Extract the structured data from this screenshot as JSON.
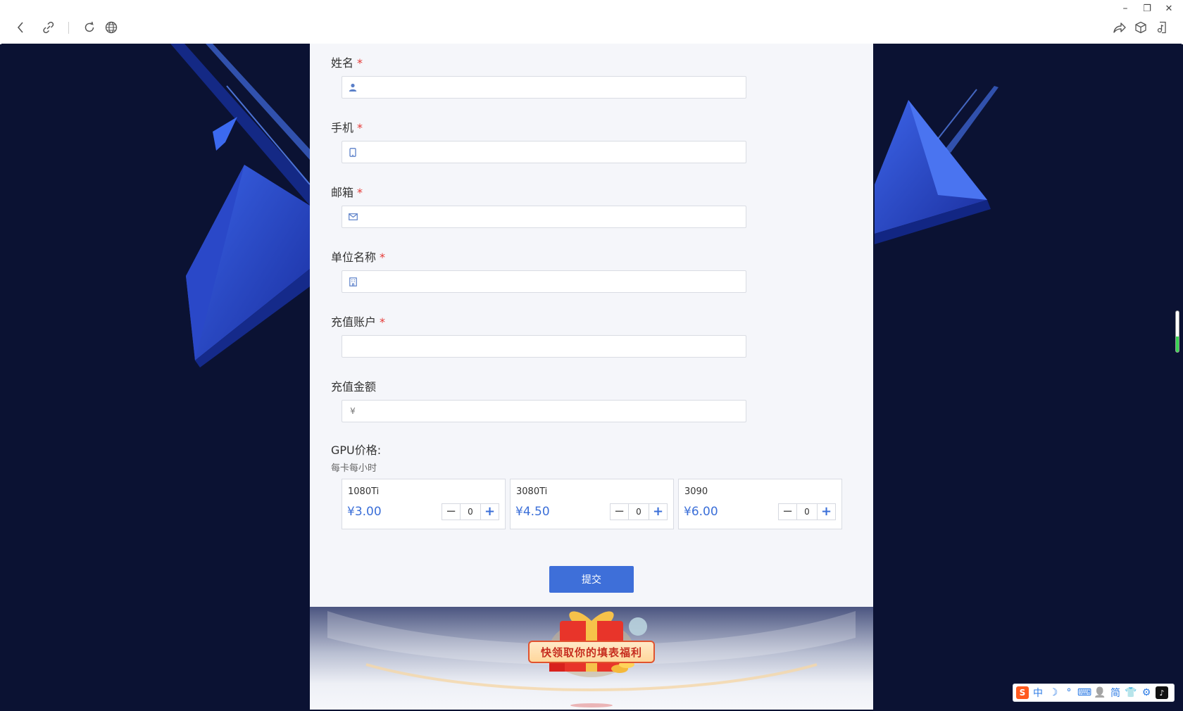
{
  "window": {
    "minimize_glyph": "–",
    "restore_glyph": "❐",
    "close_glyph": "✕"
  },
  "toolbar": {
    "icons": [
      "back-icon",
      "link-icon",
      "reload-icon",
      "globe-icon",
      "share-icon",
      "package-icon",
      "music-icon"
    ]
  },
  "form": {
    "required_mark": "*",
    "fields": [
      {
        "label": "姓名",
        "required": true,
        "icon": "user-icon",
        "value": ""
      },
      {
        "label": "手机",
        "required": true,
        "icon": "phone-icon",
        "value": ""
      },
      {
        "label": "邮箱",
        "required": true,
        "icon": "mail-icon",
        "value": ""
      },
      {
        "label": "单位名称",
        "required": true,
        "icon": "building-icon",
        "value": ""
      },
      {
        "label": "充值账户",
        "required": true,
        "icon": "",
        "value": ""
      },
      {
        "label": "充值金额",
        "required": false,
        "icon": "yen-icon",
        "icon_text": "¥",
        "value": ""
      }
    ],
    "gpu": {
      "title": "GPU价格:",
      "subtitle": "每卡每小时",
      "items": [
        {
          "name": "1080Ti",
          "price": "¥3.00",
          "qty": "0"
        },
        {
          "name": "3080Ti",
          "price": "¥4.50",
          "qty": "0"
        },
        {
          "name": "3090",
          "price": "¥6.00",
          "qty": "0"
        }
      ],
      "minus_glyph": "−",
      "plus_glyph": "+"
    },
    "submit_label": "提交"
  },
  "banner": {
    "text": "快领取你的填表福利"
  },
  "ime": {
    "logo": "S",
    "items": [
      "中",
      "☽",
      "°",
      "⌨",
      "👤",
      "简",
      "👕",
      "⚙",
      "♪"
    ]
  },
  "colors": {
    "accent": "#3e6fd9",
    "price": "#3b6fd8",
    "required": "#e53935",
    "background": "#0b1233"
  }
}
